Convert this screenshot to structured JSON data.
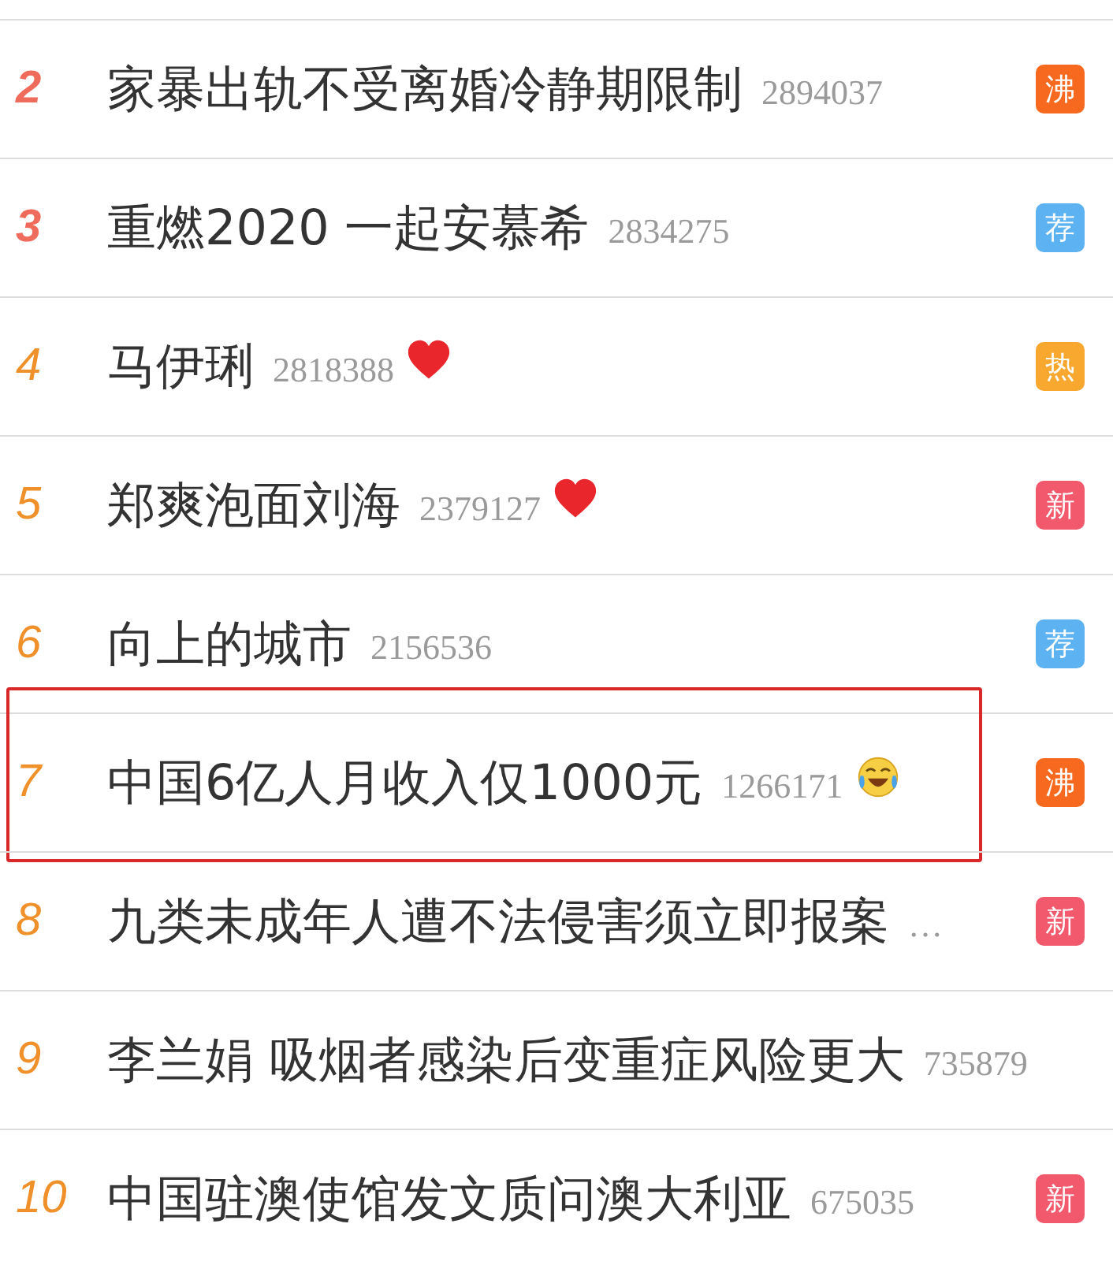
{
  "rows": [
    {
      "rank": "2",
      "kind": "top",
      "title": "家暴出轨不受离婚冷静期限制",
      "count": "2894037",
      "badge": {
        "text": "沸",
        "color": "#f7691f"
      },
      "highlighted": false
    },
    {
      "rank": "3",
      "kind": "top",
      "title": "重燃2020 一起安慕希",
      "count": "2834275",
      "badge": {
        "text": "荐",
        "color": "#5db3f2"
      },
      "highlighted": false
    },
    {
      "rank": "4",
      "kind": "normal",
      "title": "马伊琍",
      "count": "2818388",
      "emoji": {
        "kind": "heart"
      },
      "badge": {
        "text": "热",
        "color": "#f8a72f"
      },
      "highlighted": false
    },
    {
      "rank": "5",
      "kind": "normal",
      "title": "郑爽泡面刘海",
      "count": "2379127",
      "emoji": {
        "kind": "heart"
      },
      "badge": {
        "text": "新",
        "color": "#f3596d"
      },
      "highlighted": false
    },
    {
      "rank": "6",
      "kind": "normal",
      "title": "向上的城市",
      "count": "2156536",
      "badge": {
        "text": "荐",
        "color": "#5db3f2"
      },
      "highlighted": false
    },
    {
      "rank": "7",
      "kind": "normal",
      "title": "中国6亿人月收入仅1000元",
      "count": "1266171",
      "emoji": {
        "kind": "laugh-cry"
      },
      "badge": {
        "text": "沸",
        "color": "#f7691f"
      },
      "highlighted": true
    },
    {
      "rank": "8",
      "kind": "normal",
      "title": "九类未成年人遭不法侵害须立即报案",
      "count": "…",
      "badge": {
        "text": "新",
        "color": "#f3596d"
      },
      "highlighted": false
    },
    {
      "rank": "9",
      "kind": "normal",
      "title": "李兰娟 吸烟者感染后变重症风险更大",
      "count": "735879",
      "highlighted": false
    },
    {
      "rank": "10",
      "kind": "normal",
      "title": "中国驻澳使馆发文质问澳大利亚",
      "count": "675035",
      "badge": {
        "text": "新",
        "color": "#f3596d"
      },
      "highlighted": false
    }
  ]
}
